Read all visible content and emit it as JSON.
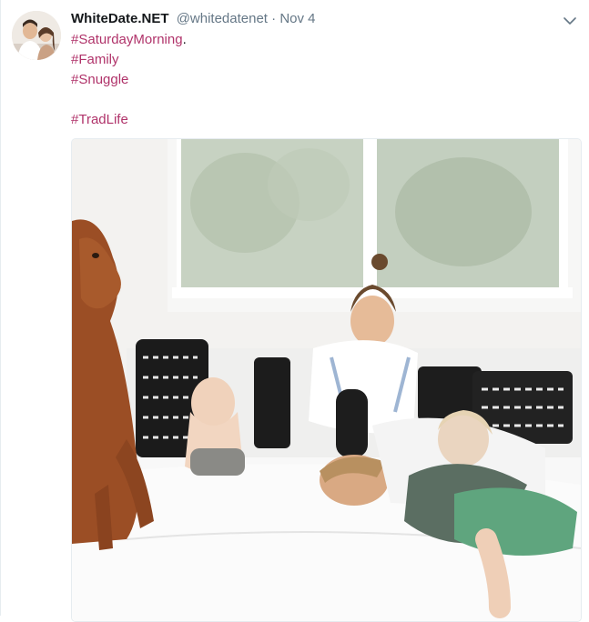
{
  "tweet": {
    "author": {
      "display_name": "WhiteDate.NET",
      "handle": "@whitedatenet",
      "avatar_icon": "profile-photo-couple"
    },
    "separator": "·",
    "date": "Nov 4",
    "lines": [
      {
        "text": "#SaturdayMorning",
        "suffix": "."
      },
      {
        "text": "#Family",
        "suffix": ""
      },
      {
        "text": "#Snuggle",
        "suffix": ""
      },
      {
        "text": "#TradLife",
        "suffix": ""
      }
    ],
    "menu_icon": "chevron-down-icon",
    "colors": {
      "hashtag": "#b0336a",
      "name": "#14171a",
      "meta": "#657786"
    },
    "media": {
      "type": "photo"
    }
  }
}
